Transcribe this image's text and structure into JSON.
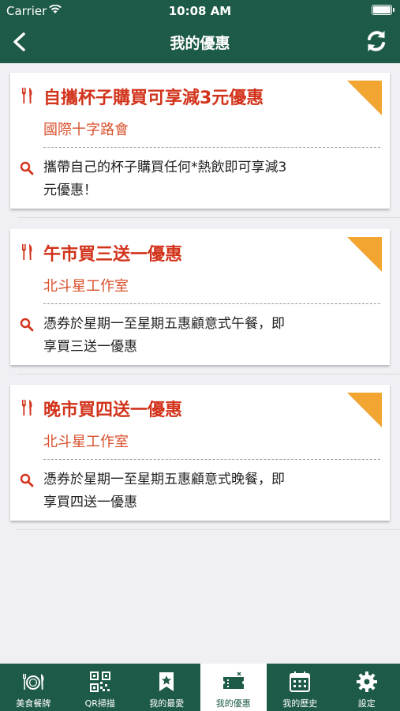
{
  "status": {
    "carrier": "Carrier",
    "time": "10:08 AM"
  },
  "nav": {
    "title": "我的優惠",
    "back_icon": "chevron-left-icon",
    "refresh_icon": "refresh-icon"
  },
  "colors": {
    "brand": "#1e5a48",
    "title_red": "#d2331b",
    "subtitle_orange": "#d9522e",
    "tag_orange": "#f2a530"
  },
  "coupons": [
    {
      "title": "自攜杯子購買可享減3元優惠",
      "shop": "國際十字路會",
      "desc_line1": "攜帶自己的杯子購買任何*熱飲即可享減3",
      "desc_line2": "元優惠！"
    },
    {
      "title": "午市買三送一優惠",
      "shop": "北斗星工作室",
      "desc_line1": "憑券於星期一至星期五惠顧意式午餐，即",
      "desc_line2": "享買三送一優惠"
    },
    {
      "title": "晚市買四送一優惠",
      "shop": "北斗星工作室",
      "desc_line1": "憑券於星期一至星期五惠顧意式晚餐，即",
      "desc_line2": "享買四送一優惠"
    }
  ],
  "tabs": [
    {
      "label": "美食餐牌",
      "icon": "plate-cutlery-icon"
    },
    {
      "label": "QR掃描",
      "icon": "qr-code-icon"
    },
    {
      "label": "我的最愛",
      "icon": "bookmark-star-icon"
    },
    {
      "label": "我的優惠",
      "icon": "coupon-ticket-icon",
      "active": true
    },
    {
      "label": "我的歷史",
      "icon": "calendar-icon"
    },
    {
      "label": "設定",
      "icon": "gear-icon"
    }
  ]
}
